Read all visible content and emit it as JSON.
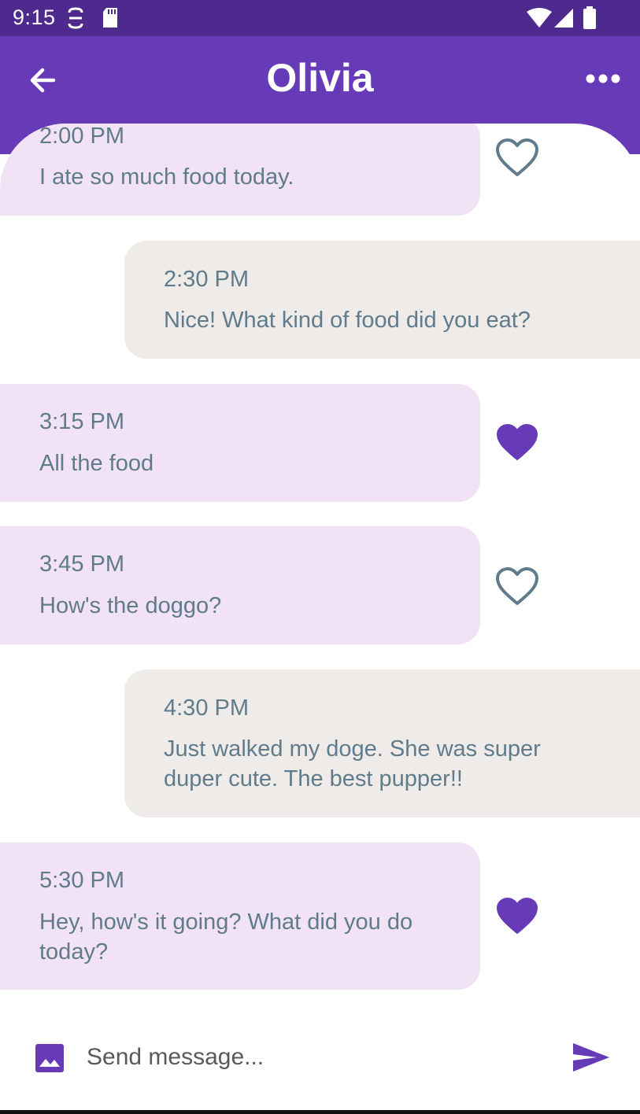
{
  "status_bar": {
    "time": "9:15",
    "icons": [
      "sync-icon",
      "sd-card-icon",
      "wifi-icon",
      "signal-icon",
      "battery-icon"
    ]
  },
  "header": {
    "title": "Olivia",
    "back_icon": "arrow-back-icon",
    "menu_icon": "more-horizontal-icon"
  },
  "messages": [
    {
      "direction": "received",
      "time": "2:00 PM",
      "text": "I ate so much food today.",
      "liked": false
    },
    {
      "direction": "sent",
      "time": "2:30 PM",
      "text": "Nice! What kind of food did you eat?"
    },
    {
      "direction": "received",
      "time": "3:15 PM",
      "text": "All the food",
      "liked": true
    },
    {
      "direction": "received",
      "time": "3:45 PM",
      "text": "How's the doggo?",
      "liked": false
    },
    {
      "direction": "sent",
      "time": "4:30 PM",
      "text": "Just walked my doge. She was super duper cute. The best pupper!!"
    },
    {
      "direction": "received",
      "time": "5:30 PM",
      "text": "Hey, how's it going? What did you do today?",
      "liked": true
    }
  ],
  "composer": {
    "placeholder": "Send message...",
    "value": "",
    "attach_icon": "image-icon",
    "send_icon": "send-icon"
  },
  "colors": {
    "status_bar": "#4e2a8e",
    "app_bar": "#673ab7",
    "accent": "#673ab7",
    "received_bubble": "#f1e3f5",
    "sent_bubble": "#eeebe8",
    "message_text": "#5f7b8c",
    "heart_outline": "#5f7b8c"
  }
}
